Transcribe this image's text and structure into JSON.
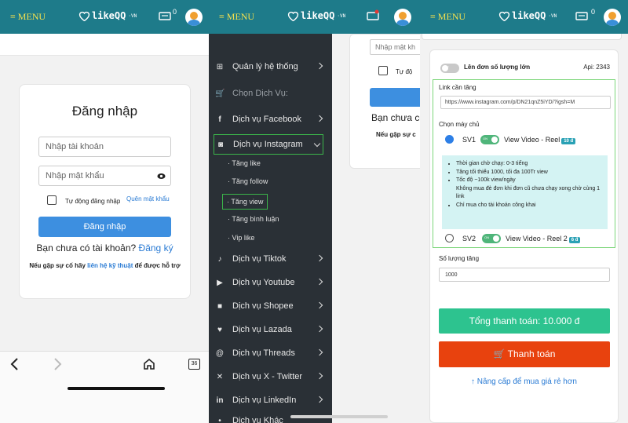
{
  "header": {
    "menu_label": "≡ MENU",
    "logo_text": "likeQQ",
    "logo_suffix": "·VN",
    "cart_count": "0"
  },
  "colors": {
    "header_bg": "#1e7b8a",
    "menu_text": "#f4e04d",
    "primary": "#3d8fe0",
    "total_button": "#2dc38f",
    "pay_button": "#e8420e",
    "sidebar_bg": "#2a3036",
    "highlight": "#3bb54a"
  },
  "login": {
    "title": "Đăng nhập",
    "username_placeholder": "Nhập tài khoản",
    "password_placeholder": "Nhập mật khẩu",
    "remember_label": "Tự động đăng nhập",
    "forgot_label": "Quên mật khẩu",
    "submit_label": "Đăng nhập",
    "no_account": "Bạn chưa có tài khoản?",
    "register_link": "Đăng ký",
    "help_prefix": "Nếu gặp sự cố hãy",
    "help_link": "liên hệ kỹ thuật",
    "help_suffix": "để được hỗ trợ"
  },
  "browser": {
    "tab_count": "36"
  },
  "sidebar": {
    "system_label": "Quản lý hệ thống",
    "choose_service": "Chọn Dịch Vụ:",
    "facebook": "Dịch vụ Facebook",
    "instagram": "Dịch vụ Instagram",
    "instagram_sub": [
      "Tăng like",
      "Tăng follow",
      "Tăng view",
      "Tăng bình luận",
      "Vip like"
    ],
    "tiktok": "Dịch vụ Tiktok",
    "youtube": "Dịch vụ Youtube",
    "shopee": "Dịch vụ Shopee",
    "lazada": "Dịch vụ Lazada",
    "threads": "Dịch vụ Threads",
    "x": "Dịch vụ X - Twitter",
    "linkedin": "Dịch vụ LinkedIn",
    "more": "Dịch vụ Khác"
  },
  "background_login": {
    "password_placeholder": "Nhập mật kh",
    "remember_fragment": "Tự độ",
    "no_account_fragment": "Bạn chưa co",
    "help_fragment": "Nếu gặp sự c"
  },
  "order": {
    "bulk_label": "Lên đơn số lượng lớn",
    "api": "Api: 2343",
    "link_label": "Link cần tăng",
    "link_value": "https://www.instagram.com/p/DN21qnZ5iYD/?igsh=M",
    "server_label": "Chọn máy chủ",
    "sv1_name": "SV1",
    "sv1_desc": "View Video - Reel",
    "sv1_price": "10 đ",
    "sv1_notes": [
      "Thời gian chờ chạy: 0-3 tiếng",
      "Tăng tối thiểu 1000, tối đa 100Tr view",
      "Tốc độ ~100k view/ngày",
      "Không mua đè đơn khi đơn cũ chưa chạy xong chờ cùng 1 link",
      "Chỉ mua cho tài khoản công khai"
    ],
    "sv2_name": "SV2",
    "sv2_desc": "View Video - Reel 2",
    "sv2_price": "6 đ",
    "qty_label": "Số lượng tăng",
    "qty_value": "1000",
    "total_label": "Tổng thanh toán: 10.000  đ",
    "pay_label": "Thanh toán",
    "upgrade_label": "Nâng cấp để mua giá rẻ hơn"
  }
}
